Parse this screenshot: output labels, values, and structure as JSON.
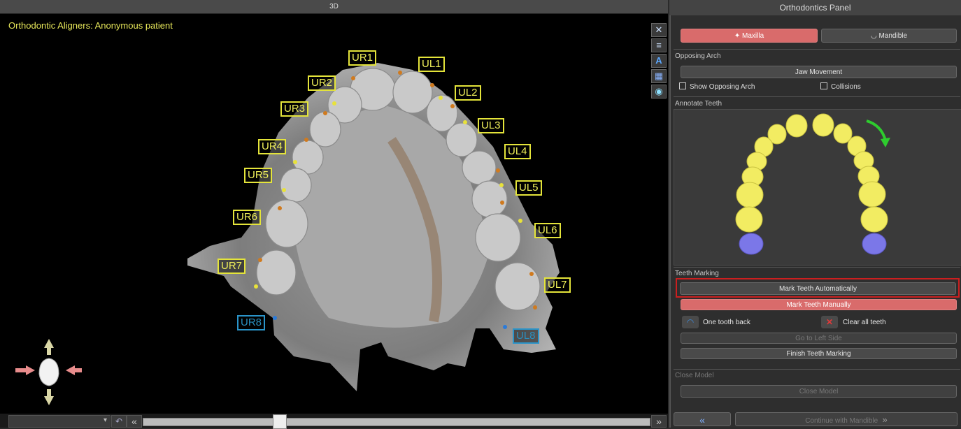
{
  "viewport": {
    "header_title": "3D",
    "patient_title": "Orthodontic Aligners: Anonymous patient",
    "tooth_tags": [
      {
        "label": "UR1",
        "state": "marked"
      },
      {
        "label": "UL1",
        "state": "marked"
      },
      {
        "label": "UR2",
        "state": "marked"
      },
      {
        "label": "UL2",
        "state": "marked"
      },
      {
        "label": "UR3",
        "state": "marked"
      },
      {
        "label": "UL3",
        "state": "marked"
      },
      {
        "label": "UR4",
        "state": "marked"
      },
      {
        "label": "UL4",
        "state": "marked"
      },
      {
        "label": "UR5",
        "state": "marked"
      },
      {
        "label": "UL5",
        "state": "marked"
      },
      {
        "label": "UR6",
        "state": "marked"
      },
      {
        "label": "UL6",
        "state": "marked"
      },
      {
        "label": "UR7",
        "state": "marked"
      },
      {
        "label": "UL7",
        "state": "marked"
      },
      {
        "label": "UR8",
        "state": "unmarked"
      },
      {
        "label": "UL8",
        "state": "unmarked"
      }
    ],
    "timeline_position": 0.27,
    "colors": {
      "tag_marked": "#e4e43a",
      "tag_unmarked": "#2a94c9",
      "patient_title": "#e8e85a"
    }
  },
  "panel": {
    "header_title": "Orthodontics Panel",
    "jaw_buttons": {
      "maxilla": "Maxilla",
      "mandible": "Mandible"
    },
    "opposing_arch": {
      "section": "Opposing Arch",
      "jaw_movement": "Jaw Movement",
      "show_opposing": "Show Opposing Arch",
      "collisions": "Collisions"
    },
    "annotate": {
      "section": "Annotate Teeth"
    },
    "teeth_marking": {
      "section": "Teeth Marking",
      "auto": "Mark Teeth Automatically",
      "manual": "Mark Teeth Manually",
      "one_back": "One tooth back",
      "clear_all": "Clear all teeth",
      "go_left": "Go to Left Side",
      "finish": "Finish Teeth Marking"
    },
    "close_model": {
      "section": "Close Model",
      "button": "Close Model"
    },
    "footer": {
      "continue": "Continue with Mandible"
    },
    "colors": {
      "active": "#d96b6b",
      "highlight": "#cc1f1f",
      "tooth_marked": "#f2ec62",
      "tooth_pending": "#7b77e8",
      "arrow": "#2ecc2e"
    }
  }
}
